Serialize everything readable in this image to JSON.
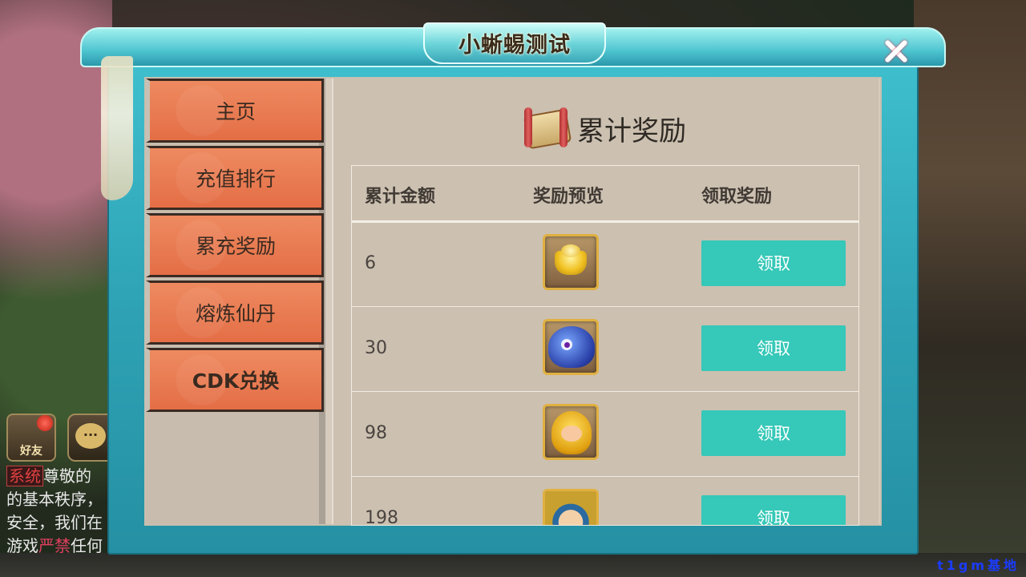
{
  "window": {
    "title": "小蜥蜴测试",
    "close": "close"
  },
  "sidebar": {
    "items": [
      {
        "label": "主页"
      },
      {
        "label": "充值排行"
      },
      {
        "label": "累充奖励"
      },
      {
        "label": "熔炼仙丹"
      },
      {
        "label": "CDK兑换"
      }
    ]
  },
  "content": {
    "title": "累计奖励",
    "columns": [
      "累计金额",
      "奖励预览",
      "领取奖励"
    ],
    "rows": [
      {
        "amount": "6",
        "reward_icon": "gold-ingot-icon",
        "action": "领取"
      },
      {
        "amount": "30",
        "reward_icon": "blue-pet-icon",
        "action": "领取"
      },
      {
        "amount": "98",
        "reward_icon": "golden-monkey-icon",
        "action": "领取"
      },
      {
        "amount": "198",
        "reward_icon": "hero-portrait-icon",
        "action": "领取"
      }
    ]
  },
  "hud": {
    "friends_label": "好友",
    "chat_icon": "chat-bubble-icon",
    "system_tag": "系统",
    "system_line1": "尊敬的",
    "system_line2": "的基本秩序，",
    "system_line3": "安全，我们在",
    "system_line4a": "游戏",
    "system_line4b": "严禁",
    "system_line4c": "任何",
    "watermark": "t1gm基地"
  },
  "colors": {
    "claim_button": "#36c8b8",
    "sidebar_tab": "#e87a50",
    "panel": "#ccc0b0",
    "frame": "#2ea3b5"
  }
}
